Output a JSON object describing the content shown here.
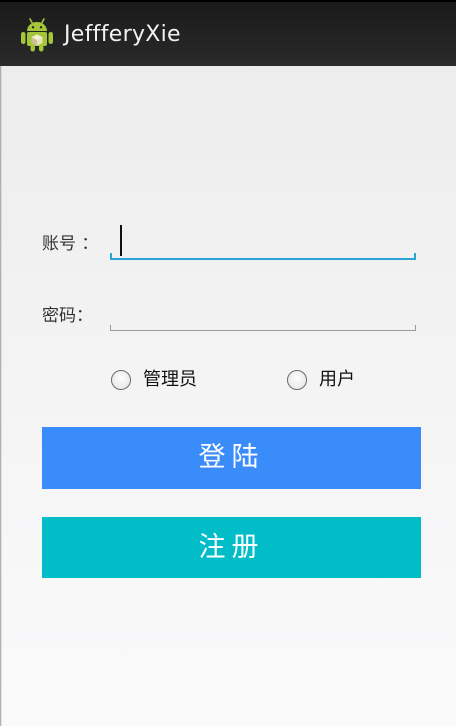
{
  "app": {
    "title": "JeffferyXie",
    "icon": "android-robot-icon"
  },
  "form": {
    "account_label": "账号 ：",
    "account_value": "",
    "password_label": "密码：",
    "password_value": "",
    "roles": [
      {
        "label": "管理员",
        "selected": false
      },
      {
        "label": "用户",
        "selected": false
      }
    ]
  },
  "buttons": {
    "login_label": "登陆",
    "register_label": "注册"
  },
  "colors": {
    "action_bar": "#222222",
    "focus_accent": "#2ba5d6",
    "login_button": "#3a8cfb",
    "register_button": "#00bdc8"
  }
}
